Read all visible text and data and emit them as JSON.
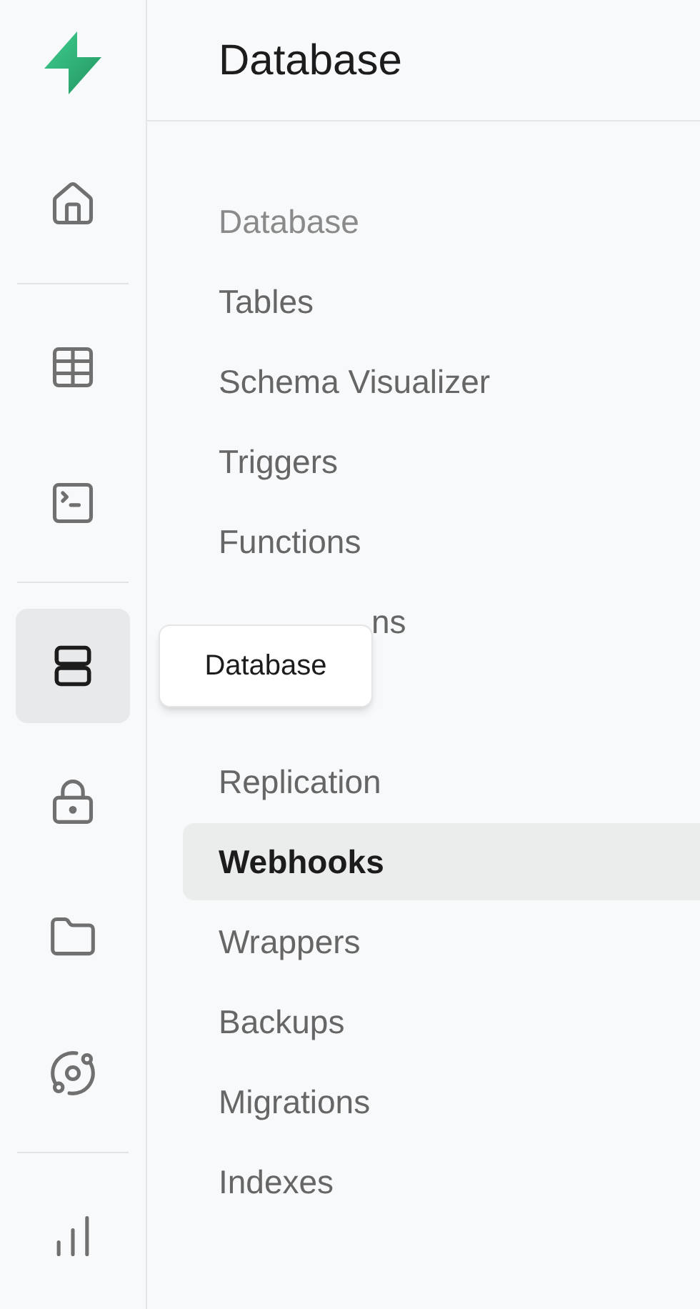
{
  "rail": {
    "groups": [
      [
        {
          "kind": "home",
          "selected": false
        }
      ],
      [
        {
          "kind": "table",
          "selected": false
        },
        {
          "kind": "terminal",
          "selected": false
        }
      ],
      [
        {
          "kind": "database",
          "selected": true,
          "tooltip": "Database"
        },
        {
          "kind": "lock",
          "selected": false
        },
        {
          "kind": "folder",
          "selected": false
        },
        {
          "kind": "orbit",
          "selected": false
        }
      ],
      [
        {
          "kind": "chart",
          "selected": false
        }
      ]
    ]
  },
  "menu": {
    "title": "Database",
    "section_label": "Database",
    "items": [
      {
        "kind": "link",
        "label": "Tables",
        "selected": false
      },
      {
        "kind": "link",
        "label": "Schema Visualizer",
        "selected": false
      },
      {
        "kind": "link",
        "label": "Triggers",
        "selected": false
      },
      {
        "kind": "link",
        "label": "Functions",
        "selected": false
      },
      {
        "kind": "covered",
        "label": "ns",
        "selected": false
      },
      {
        "kind": "link",
        "label": "Replication",
        "selected": false
      },
      {
        "kind": "link",
        "label": "Webhooks",
        "selected": true
      },
      {
        "kind": "link",
        "label": "Wrappers",
        "selected": false
      },
      {
        "kind": "link",
        "label": "Backups",
        "selected": false
      },
      {
        "kind": "link",
        "label": "Migrations",
        "selected": false
      },
      {
        "kind": "link",
        "label": "Indexes",
        "selected": false
      }
    ]
  }
}
